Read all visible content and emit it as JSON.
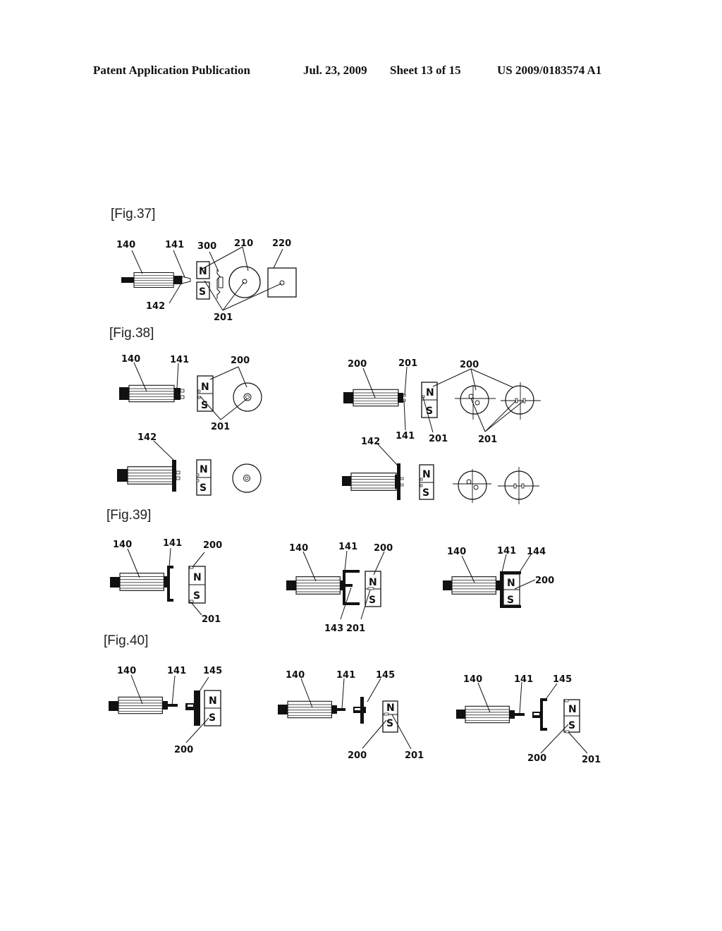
{
  "header": {
    "left": "Patent Application Publication",
    "date": "Jul. 23, 2009",
    "sheet": "Sheet 13 of 15",
    "number": "US 2009/0183574 A1"
  },
  "figures": {
    "fig37": {
      "label": "[Fig.37]",
      "refs": {
        "motor": "140",
        "shaft": "141",
        "tip": "142",
        "coil": "300",
        "magnet_disc": "210",
        "magnet_plate": "220",
        "pole_marks": "201"
      },
      "poles": {
        "north": "N",
        "south": "S"
      }
    },
    "fig38": {
      "label": "[Fig.38]",
      "left_upper": {
        "motor": "140",
        "shaft": "141",
        "magnet": "200",
        "marks": "201"
      },
      "left_lower": {
        "disc": "142"
      },
      "right_upper": {
        "motor": "200",
        "mark_top": "201",
        "shaft": "141",
        "magnet": "200",
        "mark_magnet": "201",
        "marks_discs": "201"
      },
      "right_lower": {
        "disc": "142"
      },
      "poles": {
        "north": "N",
        "south": "S"
      }
    },
    "fig39": {
      "label": "[Fig.39]",
      "a": {
        "motor": "140",
        "shaft": "141",
        "magnet": "200",
        "mark": "201"
      },
      "b": {
        "motor": "140",
        "shaft": "141",
        "magnet": "200",
        "holder": "143",
        "mark": "201"
      },
      "c": {
        "motor": "140",
        "shaft": "141",
        "cup": "144",
        "magnet": "200"
      },
      "poles": {
        "north": "N",
        "south": "S"
      }
    },
    "fig40": {
      "label": "[Fig.40]",
      "a": {
        "motor": "140",
        "shaft": "141",
        "plate": "145",
        "magnet": "200"
      },
      "b": {
        "motor": "140",
        "shaft": "141",
        "plate": "145",
        "magnet": "200",
        "mark": "201"
      },
      "c": {
        "motor": "140",
        "shaft": "141",
        "plate": "145",
        "magnet": "200",
        "mark": "201"
      },
      "poles": {
        "north": "N",
        "south": "S"
      }
    }
  }
}
